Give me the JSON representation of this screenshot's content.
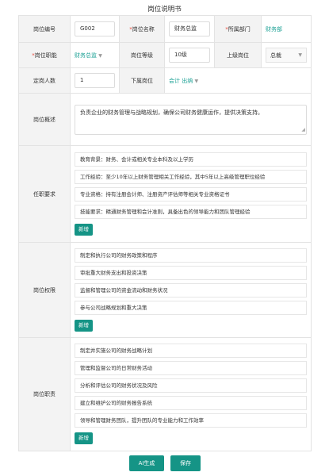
{
  "page_title": "岗位说明书",
  "fields": {
    "code": {
      "label": "岗位编号",
      "value": "G002"
    },
    "name": {
      "label": "岗位名称",
      "value": "财务总监"
    },
    "dept": {
      "label": "所属部门",
      "value": "财务部"
    },
    "job_function": {
      "label": "岗位职能",
      "value": "财务总监"
    },
    "grade": {
      "label": "岗位等级",
      "value": "10级"
    },
    "superior": {
      "label": "上级岗位",
      "value": "总裁"
    },
    "headcount": {
      "label": "定岗人数",
      "value": "1"
    },
    "subordinate": {
      "label": "下属岗位",
      "value": "会计 出纳"
    },
    "overview": {
      "label": "岗位概述",
      "value": "负责企业的财务管理与战略规划，确保公司财务健康运作，提供决策支持。"
    }
  },
  "required_mark": "*",
  "sections": [
    {
      "label": "任职要求",
      "items": [
        "教育背景：财务、会计或相关专业本科及以上学历",
        "工作经验：至少10年以上财务管理相关工作经验，其中5年以上高级管理职位经验",
        "专业资格：持有注册会计师、注册资产评估师等相关专业资格证书",
        "技能要求：精通财务管理和会计准则，具备出色的领导能力和团队管理经验"
      ]
    },
    {
      "label": "岗位权限",
      "items": [
        "制定和执行公司的财务政策和程序",
        "审批重大财务支出和投资决策",
        "监督和管理公司的资金流动和财务状况",
        "参与公司战略规划和重大决策"
      ]
    },
    {
      "label": "岗位职责",
      "items": [
        "制定并实施公司的财务战略计划",
        "管理和监督公司的日常财务活动",
        "分析和评估公司的财务状况及风险",
        "建立和维护公司的财务报告系统",
        "领导和管理财务团队，提升团队的专业能力和工作效率"
      ]
    }
  ],
  "add_label": "新增",
  "footer": {
    "ai_label": "AI生成",
    "save_label": "保存"
  }
}
